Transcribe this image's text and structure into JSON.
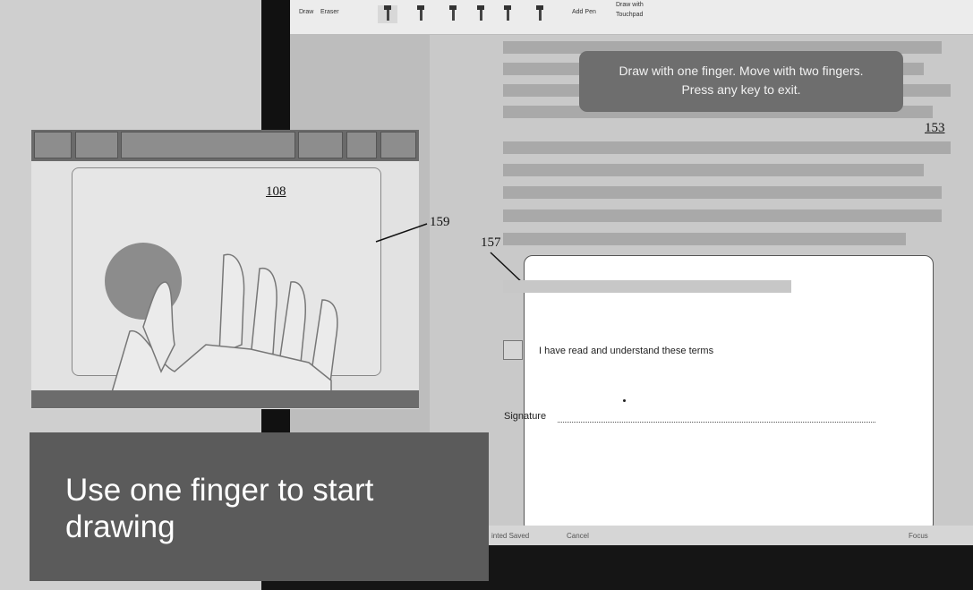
{
  "toolbar": {
    "draw_label": "Draw",
    "eraser_label": "Eraser",
    "add_pen_label": "Add Pen",
    "draw_with_label": "Draw with",
    "touchpad_label": "Touchpad"
  },
  "tooltip": {
    "line1": "Draw with one finger.  Move with two fingers.",
    "line2": "Press any key to exit."
  },
  "figure_refs": {
    "ref_153": "153",
    "ref_108": "108",
    "ref_159": "159",
    "ref_157": "157"
  },
  "dialog": {
    "terms_text": "I have read and understand these terms",
    "signature_label": "Signature"
  },
  "status_bar": {
    "left_text": "inted Saved",
    "cancel_label": "Cancel",
    "focus_label": "Focus"
  },
  "caption": {
    "text": "Use one finger to start drawing"
  },
  "colors": {
    "caption_bg": "#5b5b5b",
    "tooltip_bg": "#6e6e6e",
    "touch_circle": "#8c8c8c"
  }
}
